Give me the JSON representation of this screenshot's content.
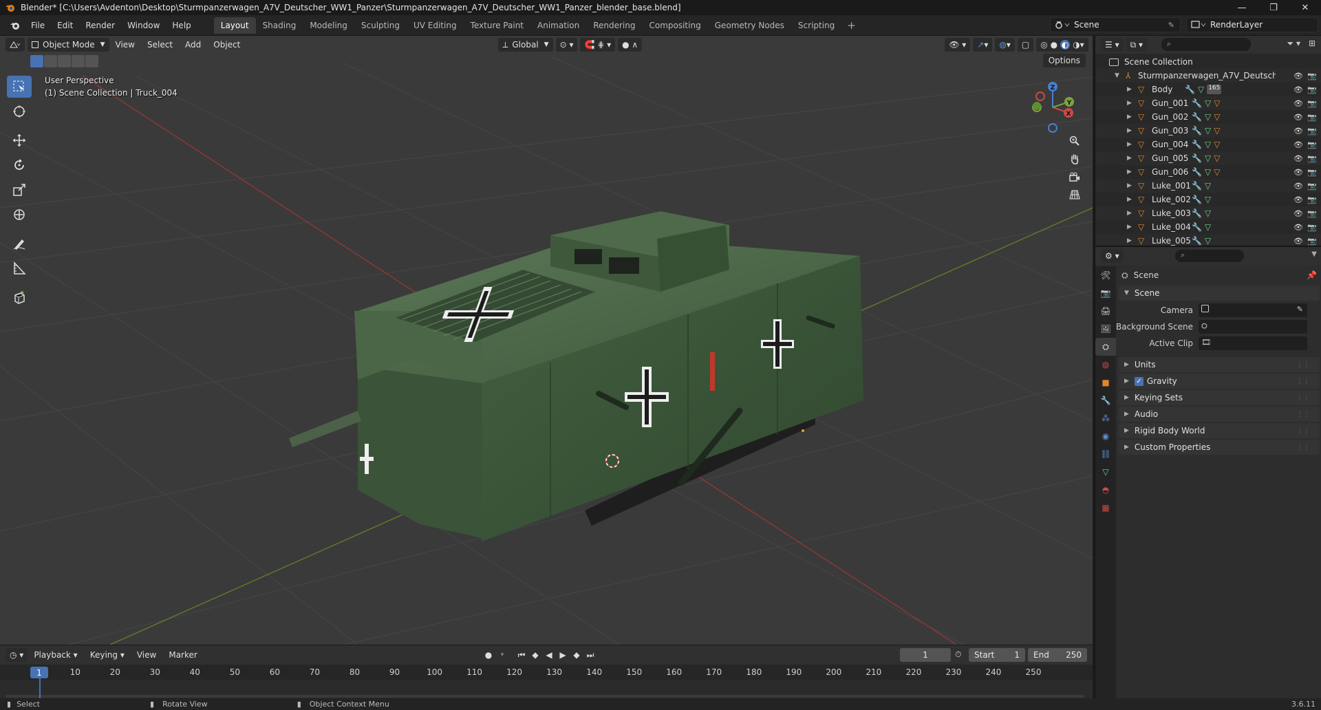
{
  "window": {
    "title": "Blender* [C:\\Users\\Avdenton\\Desktop\\Sturmpanzerwagen_A7V_Deutscher_WW1_Panzer\\Sturmpanzerwagen_A7V_Deutscher_WW1_Panzer_blender_base.blend]",
    "minimize": "—",
    "maximize": "❐",
    "close": "✕"
  },
  "menubar": {
    "items": [
      "File",
      "Edit",
      "Render",
      "Window",
      "Help"
    ],
    "workspaces": [
      "Layout",
      "Shading",
      "Modeling",
      "Sculpting",
      "UV Editing",
      "Texture Paint",
      "Animation",
      "Rendering",
      "Compositing",
      "Geometry Nodes",
      "Scripting"
    ],
    "active_workspace": "Layout",
    "add_tab": "+",
    "scene": "Scene",
    "render_layer": "RenderLayer"
  },
  "viewport": {
    "mode": "Object Mode",
    "menus": [
      "View",
      "Select",
      "Add",
      "Object"
    ],
    "transform_orientation": "Global",
    "options": "Options",
    "perspective": "User Perspective",
    "collection_info": "(1) Scene Collection | Truck_004",
    "gizmo_axes": {
      "x": "X",
      "y": "Y",
      "z": "Z"
    }
  },
  "timeline": {
    "menus": [
      "Playback",
      "Keying",
      "View",
      "Marker"
    ],
    "current_frame": "1",
    "start_label": "Start",
    "start": "1",
    "end_label": "End",
    "end": "250",
    "ticks": [
      "1",
      "10",
      "20",
      "30",
      "40",
      "50",
      "60",
      "70",
      "80",
      "90",
      "100",
      "110",
      "120",
      "130",
      "140",
      "150",
      "160",
      "170",
      "180",
      "190",
      "200",
      "210",
      "220",
      "230",
      "240",
      "250"
    ]
  },
  "statusbar": {
    "select": "Select",
    "rotate": "Rotate View",
    "context": "Object Context Menu",
    "version": "3.6.11"
  },
  "outliner": {
    "root": "Scene Collection",
    "collection": "Sturmpanzerwagen_A7V_Deutscher_W",
    "badge": "165",
    "items": [
      "Body",
      "Gun_001",
      "Gun_002",
      "Gun_003",
      "Gun_004",
      "Gun_005",
      "Gun_006",
      "Luke_001",
      "Luke_002",
      "Luke_003",
      "Luke_004",
      "Luke_005"
    ]
  },
  "properties": {
    "context": "Scene",
    "panel_scene": "Scene",
    "camera_label": "Camera",
    "background_label": "Background Scene",
    "clip_label": "Active Clip",
    "panels": [
      "Units",
      "Gravity",
      "Keying Sets",
      "Audio",
      "Rigid Body World",
      "Custom Properties"
    ],
    "gravity_checked": true
  },
  "colors": {
    "accent": "#4772b3",
    "viewport_bg": "#393939",
    "tank_green": "#3f5a3a",
    "x_axis": "#c23b3b",
    "y_axis": "#6f9a2a",
    "object_orange": "#e0872c",
    "mesh_green": "#6fd38a"
  }
}
